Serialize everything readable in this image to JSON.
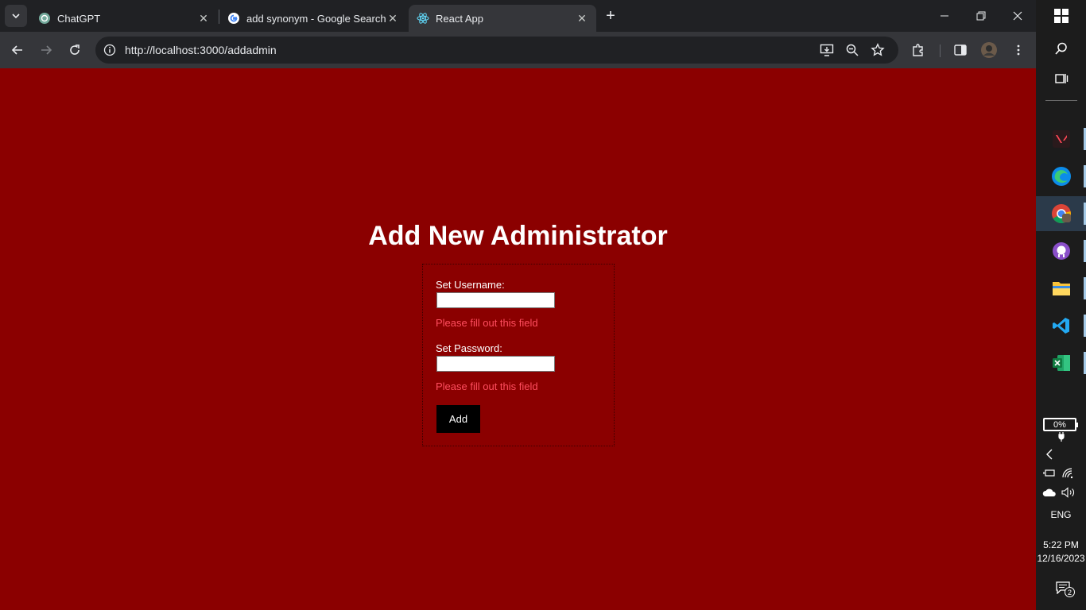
{
  "browser": {
    "tabs": [
      {
        "title": "ChatGPT",
        "icon": "chatgpt-icon",
        "active": false
      },
      {
        "title": "add synonym - Google Search",
        "icon": "google-icon",
        "active": false
      },
      {
        "title": "React App",
        "icon": "react-icon",
        "active": true
      }
    ],
    "url": "http://localhost:3000/addadmin"
  },
  "page": {
    "heading": "Add New Administrator",
    "username_label": "Set Username:",
    "username_value": "",
    "username_error": "Please fill out this field",
    "password_label": "Set Password:",
    "password_value": "",
    "password_error": "Please fill out this field",
    "add_button": "Add",
    "background_color": "#8b0000",
    "error_color": "#ff4d5e"
  },
  "taskbar": {
    "battery": "0%",
    "language": "ENG",
    "time": "5:22 PM",
    "date": "12/16/2023",
    "notifications": "2"
  }
}
